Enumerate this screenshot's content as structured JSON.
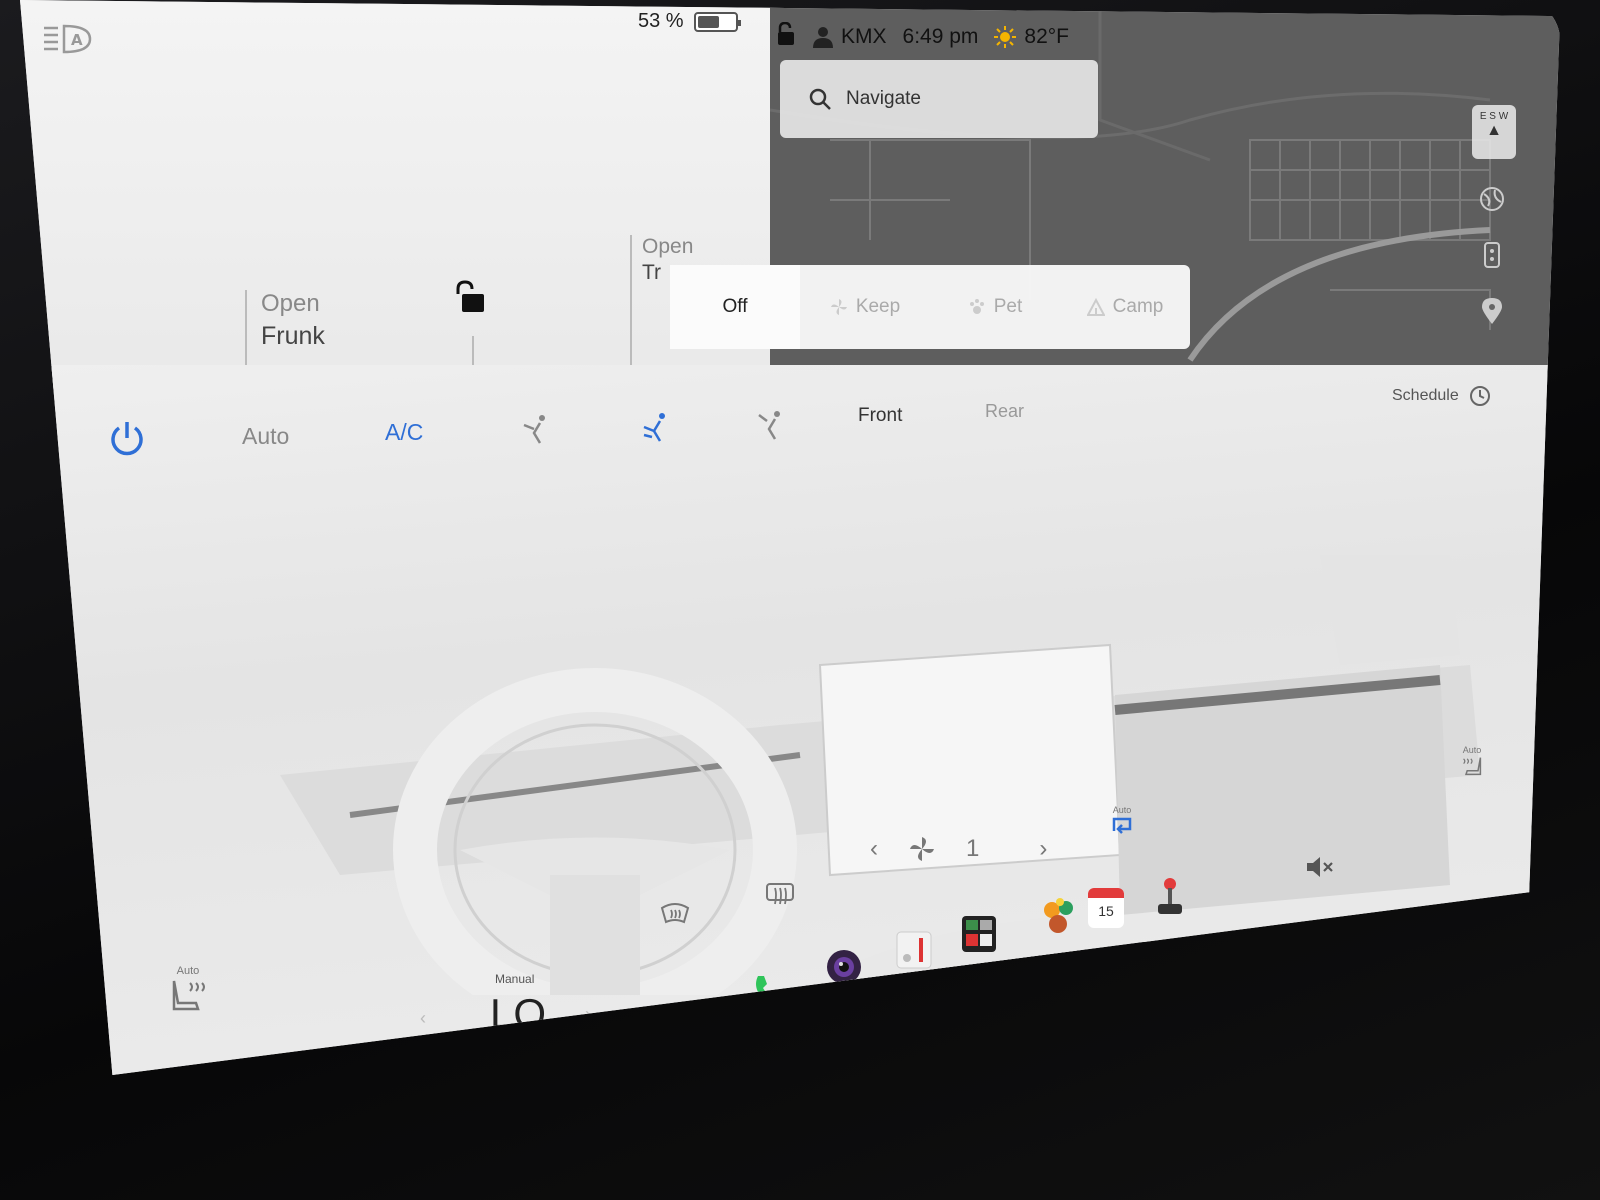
{
  "car": {
    "battery_percent": "53 %",
    "battery_level": 0.53,
    "frunk": {
      "line1": "Open",
      "line2": "Frunk"
    },
    "trunk": {
      "line1": "Open",
      "line2": "Tr"
    }
  },
  "status_bar": {
    "profile": "KMX",
    "time": "6:49 pm",
    "temperature": "82°F"
  },
  "navigate": {
    "label": "Navigate"
  },
  "climate_keeper": {
    "options": [
      {
        "label": "Off",
        "active": true
      },
      {
        "label": "Keep",
        "active": false
      },
      {
        "label": "Pet",
        "active": false
      },
      {
        "label": "Camp",
        "active": false
      }
    ]
  },
  "climate": {
    "auto_label": "Auto",
    "ac_label": "A/C",
    "front_label": "Front",
    "rear_label": "Rear",
    "schedule_label": "Schedule",
    "fan_speed": "1",
    "left_seat_label": "Auto",
    "right_seat_label": "Auto",
    "recirc_label": "Auto",
    "temp_mode": "Manual",
    "temp_value": "LO"
  },
  "dock": {
    "calendar_day": "15"
  },
  "colors": {
    "accent_blue": "#2f6fd6",
    "phone_green": "#2fc45a",
    "map_gray": "#5e5e5e"
  }
}
